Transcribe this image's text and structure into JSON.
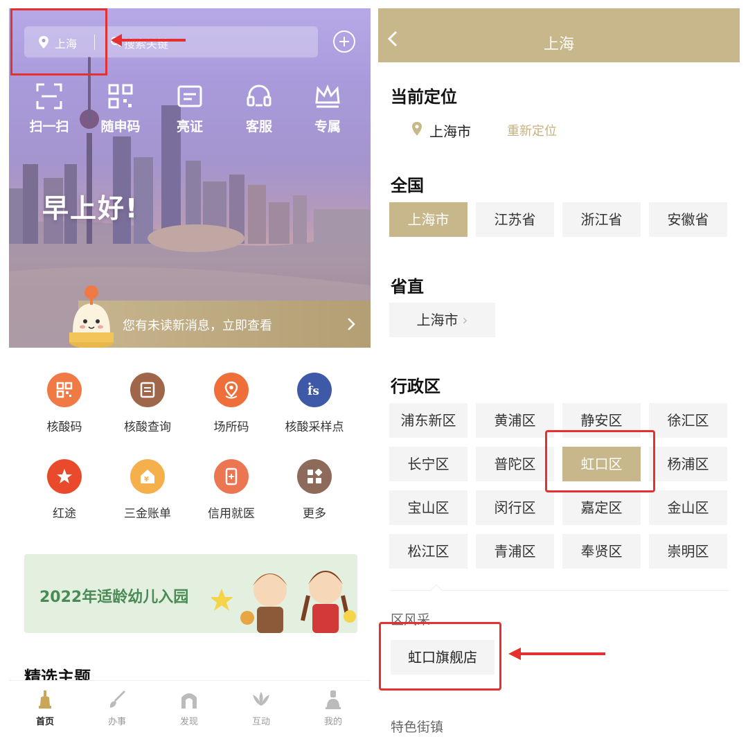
{
  "left": {
    "search": {
      "location": "上海",
      "placeholder": "搜索关键"
    },
    "quick_actions": [
      {
        "label": "扫一扫",
        "icon": "scan-icon"
      },
      {
        "label": "随申码",
        "icon": "qr-code-icon"
      },
      {
        "label": "亮证",
        "icon": "card-icon"
      },
      {
        "label": "客服",
        "icon": "headset-icon"
      },
      {
        "label": "专属",
        "icon": "crown-icon"
      }
    ],
    "greeting": "早上好!",
    "message_bar": "您有未读新消息，立即查看",
    "services": [
      {
        "label": "核酸码",
        "icon": "qr-code-icon",
        "color": "#f07a45"
      },
      {
        "label": "核酸查询",
        "icon": "document-icon",
        "color": "#a0664a"
      },
      {
        "label": "场所码",
        "icon": "location-pin-icon",
        "color": "#ef6f3b"
      },
      {
        "label": "核酸采样点",
        "icon": "sampling-icon",
        "color": "#3e59a8"
      },
      {
        "label": "红途",
        "icon": "star-icon",
        "color": "#ea4a2c"
      },
      {
        "label": "三金账单",
        "icon": "money-house-icon",
        "color": "#f5b04c"
      },
      {
        "label": "信用就医",
        "icon": "phone-icon",
        "color": "#ec7552"
      },
      {
        "label": "更多",
        "icon": "more-grid-icon",
        "color": "#8d6a5a"
      }
    ],
    "banner": "2022年适龄幼儿入园",
    "section_title": "精选主题",
    "tabs": [
      {
        "label": "首页",
        "icon": "home-icon"
      },
      {
        "label": "办事",
        "icon": "brush-icon"
      },
      {
        "label": "发现",
        "icon": "archway-icon"
      },
      {
        "label": "互动",
        "icon": "flower-icon"
      },
      {
        "label": "我的",
        "icon": "person-icon"
      }
    ]
  },
  "right": {
    "title": "上海",
    "current_location_heading": "当前定位",
    "current_city": "上海市",
    "relocate": "重新定位",
    "nation_heading": "全国",
    "provinces": [
      "上海市",
      "江苏省",
      "浙江省",
      "安徽省"
    ],
    "province_direct_heading": "省直",
    "province_direct": "上海市",
    "district_heading": "行政区",
    "districts": [
      "浦东新区",
      "黄浦区",
      "静安区",
      "徐汇区",
      "长宁区",
      "普陀区",
      "虹口区",
      "杨浦区",
      "宝山区",
      "闵行区",
      "嘉定区",
      "金山区",
      "松江区",
      "青浦区",
      "奉贤区",
      "崇明区"
    ],
    "district_style_heading": "区风采",
    "district_store": "虹口旗舰店",
    "featured_towns_heading": "特色街镇"
  },
  "colors": {
    "accent_gold": "#c7b78b",
    "annotation_red": "#e53030"
  }
}
